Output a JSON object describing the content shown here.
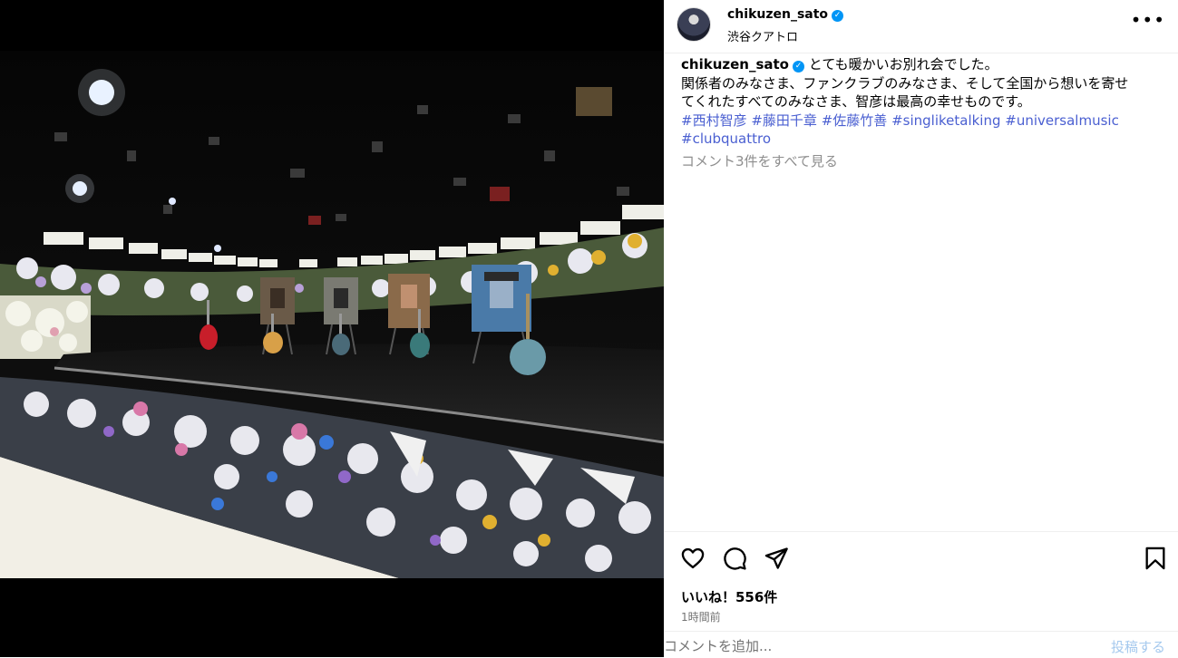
{
  "post": {
    "username": "chikuzen_sato",
    "location": "渋谷クアトロ",
    "more_icon": "more-horizontal-icon"
  },
  "caption": {
    "username": "chikuzen_sato",
    "line1": "とても暖かいお別れ会でした。",
    "line2": "関係者のみなさま、ファンクラブのみなさま、そして全国から想いを寄せ",
    "line3": "てくれたすべてのみなさま、智彦は最高の幸せものです。",
    "hashtags": [
      "#西村智彦",
      "#藤田千章",
      "#佐藤竹善",
      "#singliketalking",
      "#universalmusic",
      "#clubquattro"
    ]
  },
  "comments": {
    "view_all": "コメント3件をすべて見る"
  },
  "actions": {
    "like_icon": "heart-icon",
    "comment_icon": "comment-icon",
    "share_icon": "send-icon",
    "save_icon": "bookmark-icon"
  },
  "likes": "いいね！556件",
  "timestamp": "1時間前",
  "composer": {
    "placeholder": "コメントを追加...",
    "post_label": "投稿する",
    "post_color": "#a5c9ee"
  },
  "colors": {
    "link": "#4a5fd1",
    "verified": "#0095f6",
    "muted": "#8e8e8e"
  }
}
